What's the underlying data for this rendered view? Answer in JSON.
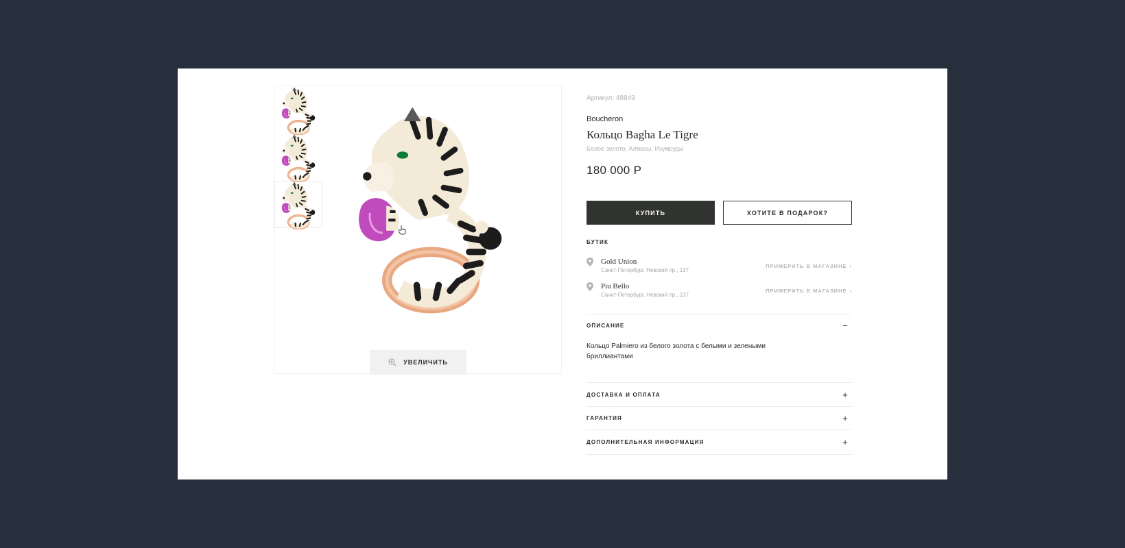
{
  "product": {
    "sku": "Артикул: 48849",
    "brand": "Boucheron",
    "title": "Кольцо Bagha Le Tigre",
    "materials": "Белое золото, Алмазы, Изумруды",
    "price": "180 000 Р"
  },
  "gallery": {
    "zoom_label": "УВЕЛИЧИТЬ",
    "zoom_icon": "zoom-in-icon",
    "active_thumb": 3
  },
  "actions": {
    "buy_label": "КУПИТЬ",
    "gift_label": "ХОТИТЕ В ПОДАРОК?"
  },
  "boutique": {
    "heading": "БУТИК",
    "stores": [
      {
        "name": "Gold Union",
        "address": "Санкт-Петербург, Невский пр., 137",
        "action": "ПРИМЕРИТЬ В МАГАЗИНЕ"
      },
      {
        "name": "Piu Bello",
        "address": "Санкт-Петербург, Невский пр., 137",
        "action": "ПРИМЕРИТЬ В МАГАЗИНЕ"
      }
    ]
  },
  "accordion": {
    "description": {
      "label": "ОПИСАНИЕ",
      "icon": "−",
      "text": "Кольцо Palmiero из белого золота с белыми и зелеными бриллиантами"
    },
    "delivery": {
      "label": "ДОСТАВКА И ОПЛАТА",
      "icon": "+"
    },
    "warranty": {
      "label": "ГАРАНТИЯ",
      "icon": "+"
    },
    "extra": {
      "label": "ДОПОЛНИТЕЛЬНАЯ ИНФОРМАЦИЯ",
      "icon": "+"
    }
  },
  "colors": {
    "background": "#262f3b",
    "button_dark": "#30332f",
    "muted_text": "#b4b4b4"
  }
}
